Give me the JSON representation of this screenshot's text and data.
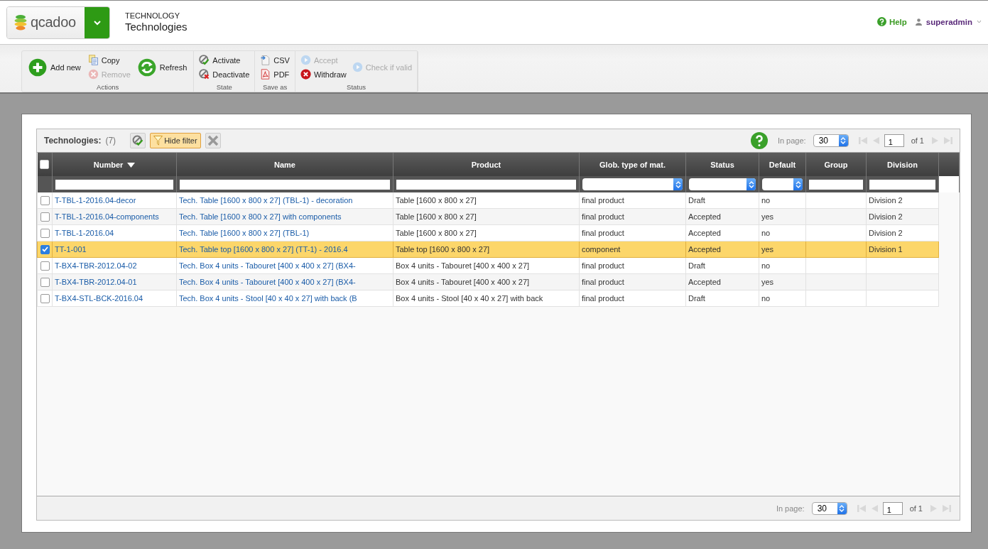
{
  "header": {
    "logo": "qcadoo",
    "breadcrumb": "TECHNOLOGY",
    "title": "Technologies",
    "help": "Help",
    "user": "superadmin"
  },
  "toolbar": [
    {
      "label": "Actions",
      "columns": [
        [
          {
            "label": "Add new",
            "kind": "large",
            "disabled": false
          }
        ],
        [
          {
            "label": "Copy",
            "kind": "small",
            "disabled": false
          },
          {
            "label": "Remove",
            "kind": "small",
            "disabled": true
          }
        ],
        [
          {
            "label": "Refresh",
            "kind": "large",
            "disabled": false
          }
        ]
      ]
    },
    {
      "label": "State",
      "columns": [
        [
          {
            "label": "Activate",
            "kind": "small",
            "disabled": false
          },
          {
            "label": "Deactivate",
            "kind": "small",
            "disabled": false
          }
        ]
      ]
    },
    {
      "label": "Save as",
      "columns": [
        [
          {
            "label": "CSV",
            "kind": "small",
            "disabled": false
          },
          {
            "label": "PDF",
            "kind": "small",
            "disabled": false
          }
        ]
      ]
    },
    {
      "label": "Status",
      "columns": [
        [
          {
            "label": "Accept",
            "kind": "small",
            "disabled": true
          },
          {
            "label": "Withdraw",
            "kind": "small",
            "disabled": false
          }
        ],
        [
          {
            "label": "Check if valid",
            "kind": "small",
            "disabled": true
          }
        ]
      ]
    }
  ],
  "grid": {
    "title": "Technologies:",
    "count": "(7)",
    "filter_button": {
      "label": "Hide filter",
      "active": true
    },
    "top_pager": {
      "label": "In page:",
      "per_page": "30",
      "page": "1",
      "total": "of 1"
    },
    "select_all_checked": false,
    "columns": [
      {
        "label": "Number",
        "sorted": true,
        "kind": "text"
      },
      {
        "label": "Name",
        "sorted": false,
        "kind": "text"
      },
      {
        "label": "Product",
        "sorted": false,
        "kind": "text"
      },
      {
        "label": "Glob. type of mat.",
        "sorted": false,
        "kind": "select"
      },
      {
        "label": "Status",
        "sorted": false,
        "kind": "select"
      },
      {
        "label": "Default",
        "sorted": false,
        "kind": "select"
      },
      {
        "label": "Group",
        "sorted": false,
        "kind": "text"
      },
      {
        "label": "Division",
        "sorted": false,
        "kind": "text"
      }
    ],
    "rows": [
      {
        "selected": false,
        "number": "T-TBL-1-2016.04-decor",
        "name": "Tech. Table [1600 x 800 x 27] (TBL-1) - decoration",
        "product": "Table [1600 x 800 x 27]",
        "type": "final product",
        "status": "Draft",
        "default": "no",
        "division": "Division 2"
      },
      {
        "selected": false,
        "number": "T-TBL-1-2016.04-components",
        "name": "Tech. Table [1600 x 800 x 27] with components",
        "product": "Table [1600 x 800 x 27]",
        "type": "final product",
        "status": "Accepted",
        "default": "yes",
        "division": "Division 2"
      },
      {
        "selected": false,
        "number": "T-TBL-1-2016.04",
        "name": "Tech. Table [1600 x 800 x 27] (TBL-1)",
        "product": "Table [1600 x 800 x 27]",
        "type": "final product",
        "status": "Accepted",
        "default": "no",
        "division": "Division 2"
      },
      {
        "selected": true,
        "number": "TT-1-001",
        "name": "Tech. Table top [1600 x 800 x 27] (TT-1) - 2016.4",
        "product": "Table top [1600 x 800 x 27]",
        "type": "component",
        "status": "Accepted",
        "default": "yes",
        "division": "Division 1"
      },
      {
        "selected": false,
        "number": "T-BX4-TBR-2012.04-02",
        "name": "Tech. Box 4 units - Tabouret [400 x 400 x 27] (BX4-",
        "product": "Box 4 units - Tabouret [400 x 400 x 27]",
        "type": "final product",
        "status": "Draft",
        "default": "no"
      },
      {
        "selected": false,
        "number": "T-BX4-TBR-2012.04-01",
        "name": "Tech. Box 4 units - Tabouret [400 x 400 x 27] (BX4-",
        "product": "Box 4 units - Tabouret [400 x 400 x 27]",
        "type": "final product",
        "status": "Accepted",
        "default": "yes"
      },
      {
        "selected": false,
        "number": "T-BX4-STL-BCK-2016.04",
        "name": "Tech. Box 4 units - Stool [40 x 40 x 27] with back (B",
        "product": "Box 4 units - Stool [40 x 40 x 27] with back",
        "type": "final product",
        "status": "Draft",
        "default": "no"
      }
    ],
    "bottom_pager": {
      "label": "In page:",
      "per_page": "30",
      "page": "1",
      "total": "of 1"
    }
  }
}
